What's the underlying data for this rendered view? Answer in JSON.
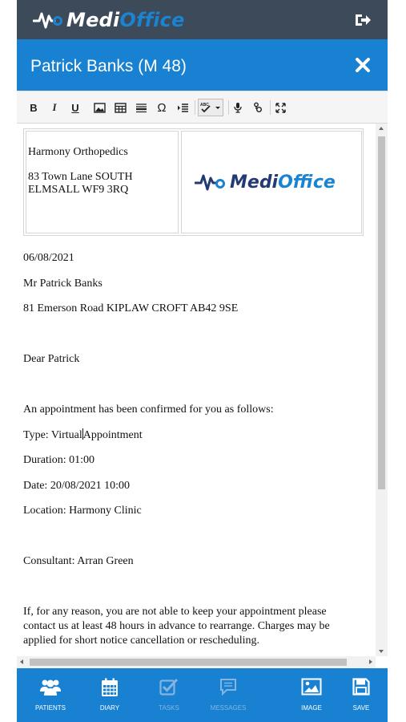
{
  "app": {
    "brand_part1": "Medi",
    "brand_part2": "Office"
  },
  "patient": {
    "title": "Patrick Banks (M 48)"
  },
  "toolbar": {
    "bold": "B",
    "italic": "I",
    "underline": "U",
    "omega": "Ω"
  },
  "letter": {
    "practice_name": "Harmony Orthopedics",
    "practice_address_1": "83 Town Lane SOUTH",
    "practice_address_2": "ELMSALL WF9 3RQ",
    "logo_part1": "Medi",
    "logo_part2": "Office",
    "date": "06/08/2021",
    "recipient_name": "Mr Patrick Banks",
    "recipient_address": "81 Emerson Road KIPLAW CROFT AB42 9SE",
    "salutation": "Dear Patrick",
    "intro": "An appointment has been confirmed for you as follows:",
    "type_prefix": "Type: Virtual",
    "type_suffix": "Appointment",
    "duration": "Duration: 01:00",
    "date_line": "Date: 20/08/2021 10:00",
    "location": "Location: Harmony Clinic",
    "consultant": "Consultant: Arran Green",
    "closing_paragraph": "If, for any reason, you are not able to keep your appointment please contact us at least 48 hours in advance to rearrange.  Charges may be applied for short notice cancellation or rescheduling."
  },
  "nav": {
    "patients": "PATIENTS",
    "diary": "DIARY",
    "tasks": "TASKS",
    "messages": "MESSAGES",
    "image": "IMAGE",
    "save": "SAVE"
  },
  "colors": {
    "topbar": "#3d4a59",
    "accent_blue": "#1981d2",
    "logo_navy": "#233a73",
    "disabled_nav": "#84b4e0"
  }
}
